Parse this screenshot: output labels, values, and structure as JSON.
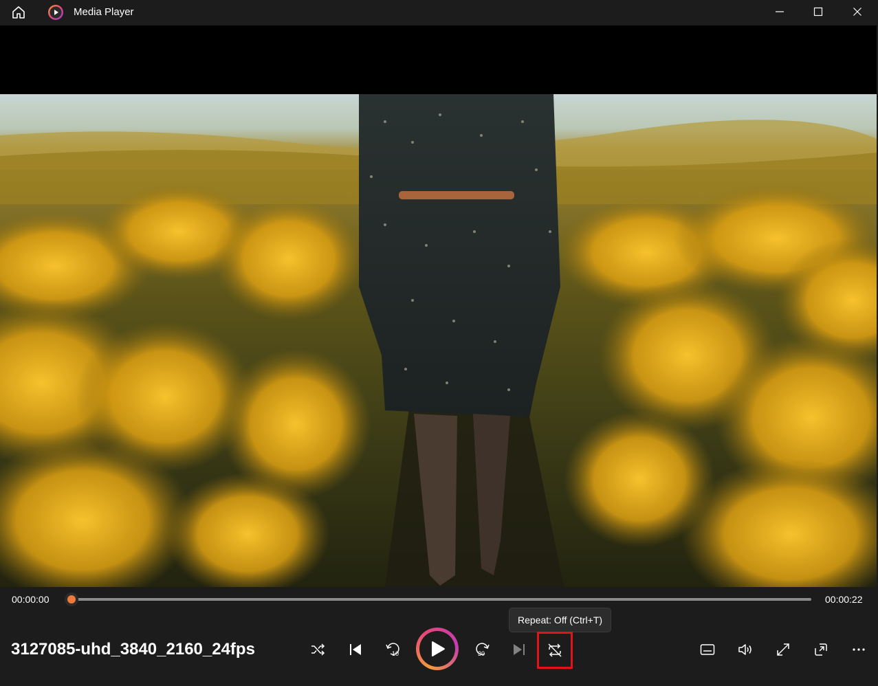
{
  "window": {
    "title": "Media Player"
  },
  "titlebar": {
    "home_icon": "home-icon",
    "app_icon": "media-player-logo-icon",
    "minimize_icon": "minimize-icon",
    "maximize_icon": "maximize-icon",
    "close_icon": "close-icon"
  },
  "playback": {
    "current_time": "00:00:00",
    "total_time": "00:00:22",
    "progress_fraction": 0.0,
    "file_title": "3127085-uhd_3840_2160_24fps"
  },
  "tooltip": {
    "text": "Repeat: Off (Ctrl+T)"
  },
  "controls": {
    "left": [
      "shuffle-icon",
      "previous-icon",
      "skip-back-10-icon",
      "play-icon",
      "skip-forward-30-icon",
      "next-icon",
      "repeat-off-icon"
    ],
    "right": [
      "subtitles-icon",
      "volume-icon",
      "fullscreen-icon",
      "mini-player-icon",
      "more-options-icon"
    ],
    "skip_back_label": "10",
    "skip_forward_label": "30"
  },
  "colors": {
    "accent": "#f07a3a",
    "background": "#1c1c1c",
    "highlight_box": "#e0141a",
    "play_ring_gradient": [
      "#f49a3a",
      "#e5487a",
      "#c43bb0"
    ]
  }
}
